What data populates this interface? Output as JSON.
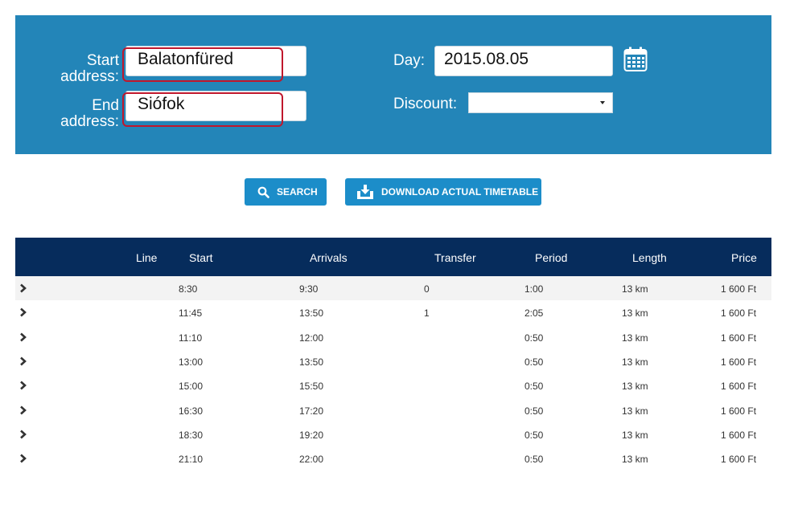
{
  "form": {
    "start_label": "Start\naddress:",
    "start_value": "Balatonfüred",
    "end_label": "End\naddress:",
    "end_value": "Siófok",
    "day_label": "Day:",
    "day_value": "2015.08.05",
    "discount_label": "Discount:",
    "discount_value": ""
  },
  "buttons": {
    "search": "SEARCH",
    "download": "DOWNLOAD ACTUAL TIMETABLE"
  },
  "table": {
    "headers": [
      "Line",
      "Start",
      "Arrivals",
      "Transfer",
      "Period",
      "Length",
      "Price"
    ],
    "rows": [
      {
        "start": "8:30",
        "arrival": "9:30",
        "transfer": "0",
        "period": "1:00",
        "length": "13 km",
        "price": "1 600 Ft"
      },
      {
        "start": "11:45",
        "arrival": "13:50",
        "transfer": "1",
        "period": "2:05",
        "length": "13 km",
        "price": "1 600 Ft"
      },
      {
        "start": "11:10",
        "arrival": "12:00",
        "transfer": "",
        "period": "0:50",
        "length": "13 km",
        "price": "1 600 Ft"
      },
      {
        "start": "13:00",
        "arrival": "13:50",
        "transfer": "",
        "period": "0:50",
        "length": "13 km",
        "price": "1 600 Ft"
      },
      {
        "start": "15:00",
        "arrival": "15:50",
        "transfer": "",
        "period": "0:50",
        "length": "13 km",
        "price": "1 600 Ft"
      },
      {
        "start": "16:30",
        "arrival": "17:20",
        "transfer": "",
        "period": "0:50",
        "length": "13 km",
        "price": "1 600 Ft"
      },
      {
        "start": "18:30",
        "arrival": "19:20",
        "transfer": "",
        "period": "0:50",
        "length": "13 km",
        "price": "1 600 Ft"
      },
      {
        "start": "21:10",
        "arrival": "22:00",
        "transfer": "",
        "period": "0:50",
        "length": "13 km",
        "price": "1 600 Ft"
      }
    ]
  },
  "colors": {
    "panel": "#2385b8",
    "button": "#1c8dc9",
    "table_header": "#062c5c",
    "highlight": "#c0172c"
  }
}
